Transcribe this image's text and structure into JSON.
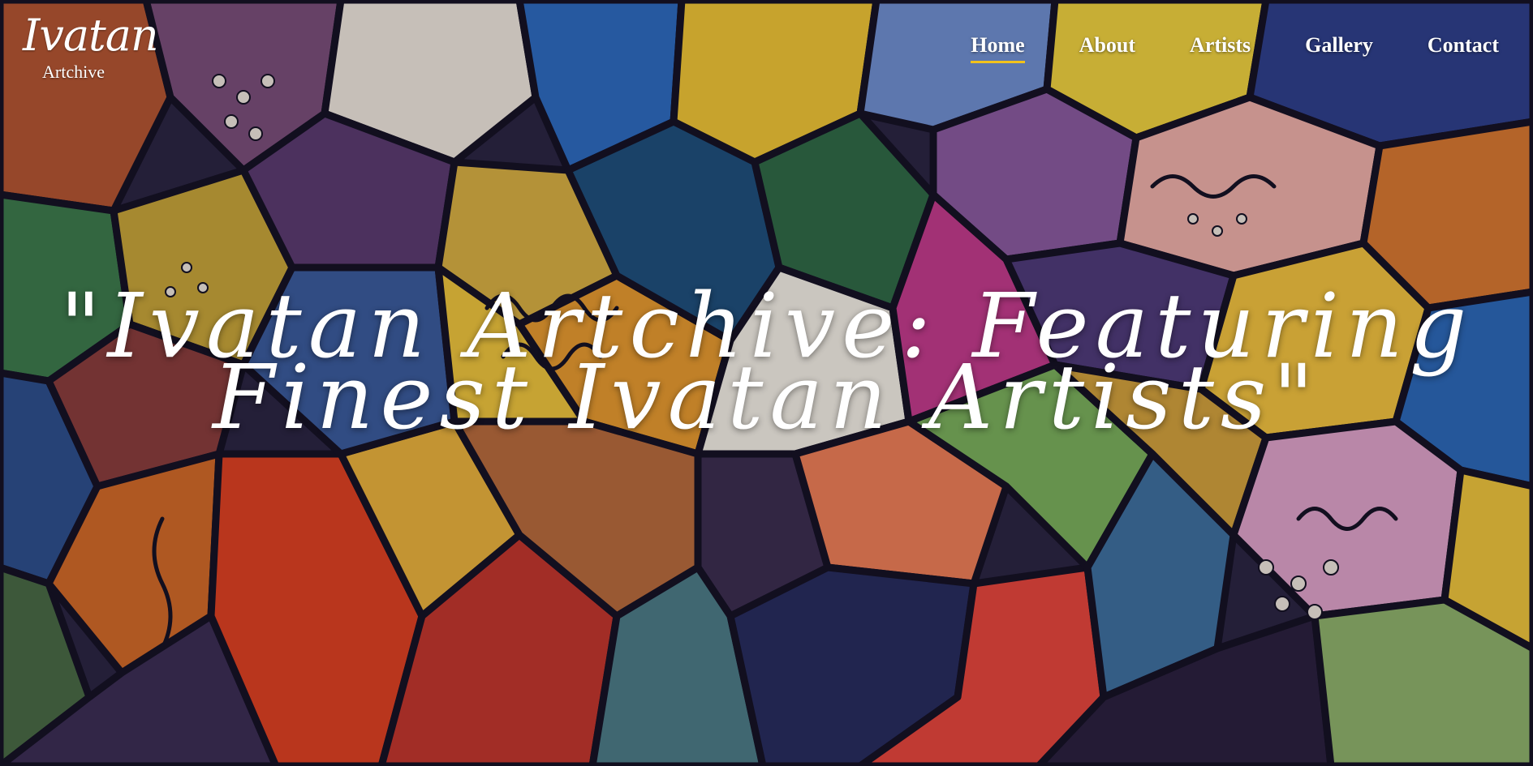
{
  "brand": {
    "logo_script": "Ivatan",
    "logo_sub": "Artchive"
  },
  "nav": {
    "items": [
      {
        "label": "Home",
        "active": true
      },
      {
        "label": "About",
        "active": false
      },
      {
        "label": "Artists",
        "active": false
      },
      {
        "label": "Gallery",
        "active": false
      },
      {
        "label": "Contact",
        "active": false
      }
    ]
  },
  "hero": {
    "title_line1": "\"Ivatan Artchive: Featuring",
    "title_line2": "Finest Ivatan Artists\""
  },
  "colors": {
    "active_underline": "#f2c21b",
    "text": "#ffffff"
  }
}
